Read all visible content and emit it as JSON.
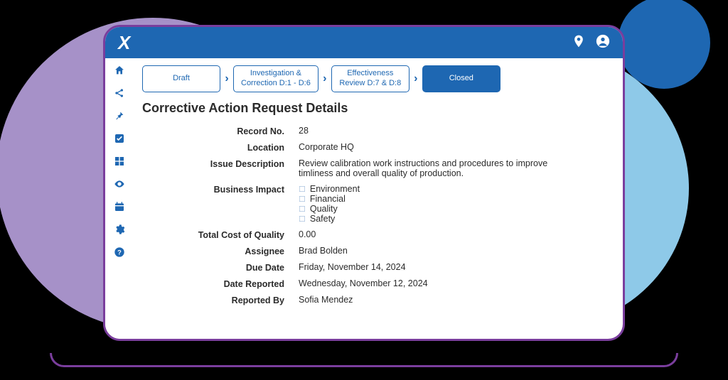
{
  "topbar": {
    "logo": "X"
  },
  "workflow": {
    "steps": [
      {
        "line1": "Draft",
        "line2": ""
      },
      {
        "line1": "Investigation &",
        "line2": "Correction D:1 - D:6"
      },
      {
        "line1": "Effectiveness",
        "line2": "Review D:7 & D:8"
      },
      {
        "line1": "Closed",
        "line2": ""
      }
    ]
  },
  "page": {
    "title": "Corrective Action Request Details"
  },
  "fields": {
    "record_no": {
      "label": "Record No.",
      "value": "28"
    },
    "location": {
      "label": "Location",
      "value": "Corporate HQ"
    },
    "issue_description": {
      "label": "Issue Description",
      "value": "Review calibration work instructions and procedures to improve timliness and overall quality of production."
    },
    "business_impact": {
      "label": "Business Impact",
      "options": [
        "Environment",
        "Financial",
        "Quality",
        "Safety"
      ]
    },
    "total_cost": {
      "label": "Total Cost of Quality",
      "value": "0.00"
    },
    "assignee": {
      "label": "Assignee",
      "value": "Brad Bolden"
    },
    "due_date": {
      "label": "Due Date",
      "value": "Friday, November 14, 2024"
    },
    "date_reported": {
      "label": "Date Reported",
      "value": "Wednesday, November 12, 2024"
    },
    "reported_by": {
      "label": "Reported By",
      "value": "Sofia Mendez"
    }
  }
}
